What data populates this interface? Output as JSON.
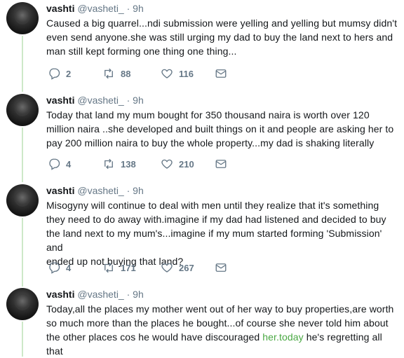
{
  "tweets": [
    {
      "name": "vashti",
      "handle": "@vasheti_",
      "dot": "·",
      "time": "9h",
      "lines": [
        "Caused a big quarrel...ndi submission were yelling and yelling but mumsy didn't",
        "even send anyone.she was still urging my dad to buy the land next to hers and",
        "man still kept forming one thing one thing..."
      ],
      "replies": "2",
      "retweets": "88",
      "likes": "116"
    },
    {
      "name": "vashti",
      "handle": "@vasheti_",
      "dot": "·",
      "time": "9h",
      "lines": [
        "Today that land my mum bought for 350 thousand naira is worth over 120",
        "million naira ..she developed and built things on it and people are asking her to",
        "pay 200 million naira to buy the whole property...my dad is shaking literally"
      ],
      "replies": "4",
      "retweets": "138",
      "likes": "210"
    },
    {
      "name": "vashti",
      "handle": "@vasheti_",
      "dot": "·",
      "time": "9h",
      "lines": [
        "Misogyny will continue to deal with men until they realize that it's something",
        "they need to do away with.imagine if my dad had listened and decided to buy",
        "the land next to my mum's...imagine if my mum started forming 'Submission' and",
        "ended up not buying that land?"
      ],
      "replies": "4",
      "retweets": "171",
      "likes": "267"
    },
    {
      "name": "vashti",
      "handle": "@vasheti_",
      "dot": "·",
      "time": "9h",
      "lines": [
        "Today,all the places my mother went out of her way to buy properties,are worth",
        "so much more than the places he bought...of course she never told him about"
      ],
      "line_last_before": "the other places cos he would have discouraged ",
      "line_last_link": "her.today",
      "line_last_after": " he's regretting all that"
    }
  ],
  "colors": {
    "link": "#4aa843",
    "thread": "#cde8c8",
    "meta": "#657786"
  },
  "icons": {
    "reply": "reply-icon",
    "retweet": "retweet-icon",
    "like": "heart-icon",
    "dm": "mail-icon"
  }
}
